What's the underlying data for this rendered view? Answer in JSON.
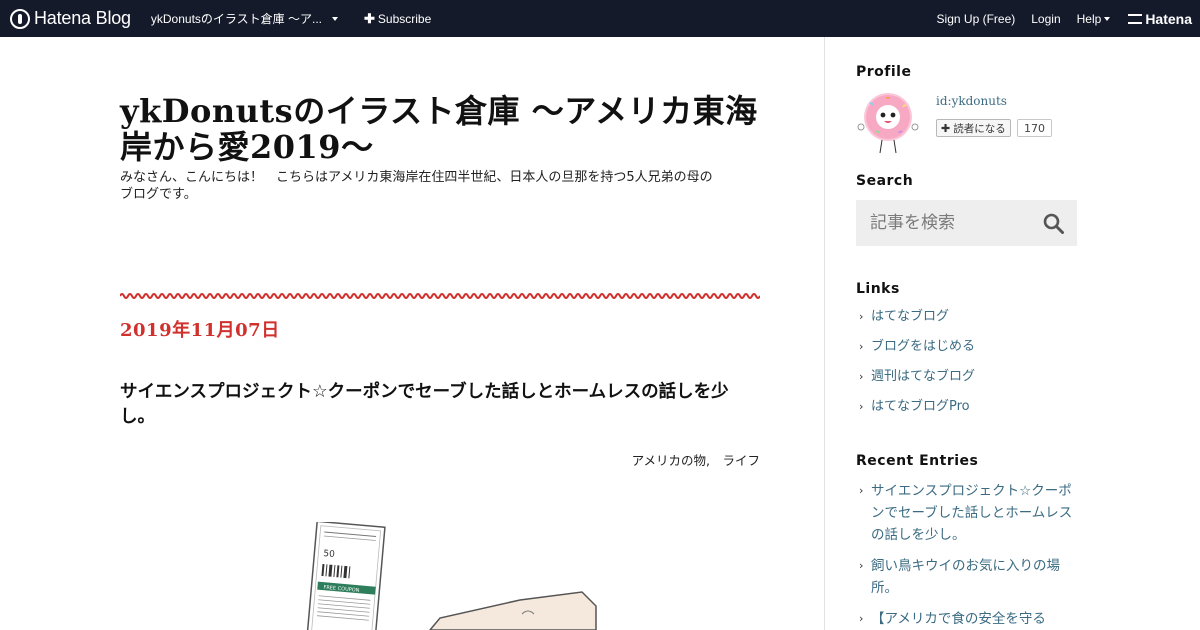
{
  "topbar": {
    "logo_text": "Hatena Blog",
    "blog_title": "ykDonutsのイラスト倉庫 ～ア...",
    "subscribe_label": "Subscribe",
    "signup_label": "Sign Up (Free)",
    "login_label": "Login",
    "help_label": "Help",
    "hatena_label": "Hatena"
  },
  "blog": {
    "title": "ykDonutsのイラスト倉庫 ～アメリカ東海岸から愛2019～",
    "description": "みなさん、こんにちは！　こちらはアメリカ東海岸在住四半世紀、日本人の旦那を持つ5人兄弟の母のブログです。"
  },
  "entry": {
    "date": "2019年11月07日",
    "title": "サイエンスプロジェクト☆クーポンでセーブした話しとホームレスの話しを少し。",
    "categories": "アメリカの物,　ライフ",
    "coupon_value": "50",
    "coupon_label": "FREE COUPON"
  },
  "sidebar": {
    "profile_heading": "Profile",
    "profile_id": "id:ykdonuts",
    "reader_button_label": "読者になる",
    "reader_count": "170",
    "search_heading": "Search",
    "search_placeholder": "記事を検索",
    "links_heading": "Links",
    "links": [
      "はてなブログ",
      "ブログをはじめる",
      "週刊はてなブログ",
      "はてなブログPro"
    ],
    "recent_heading": "Recent Entries",
    "recent": [
      "サイエンスプロジェクト☆クーポンでセーブした話しとホームレスの話しを少し。",
      "飼い鳥キウイのお気に入りの場所。",
      "【アメリカで食の安全を守る"
    ]
  },
  "colors": {
    "topbar_bg": "#141a2a",
    "date_red": "#d0312d",
    "link_blue": "#3b6b82",
    "search_bg": "#eeeeee"
  }
}
